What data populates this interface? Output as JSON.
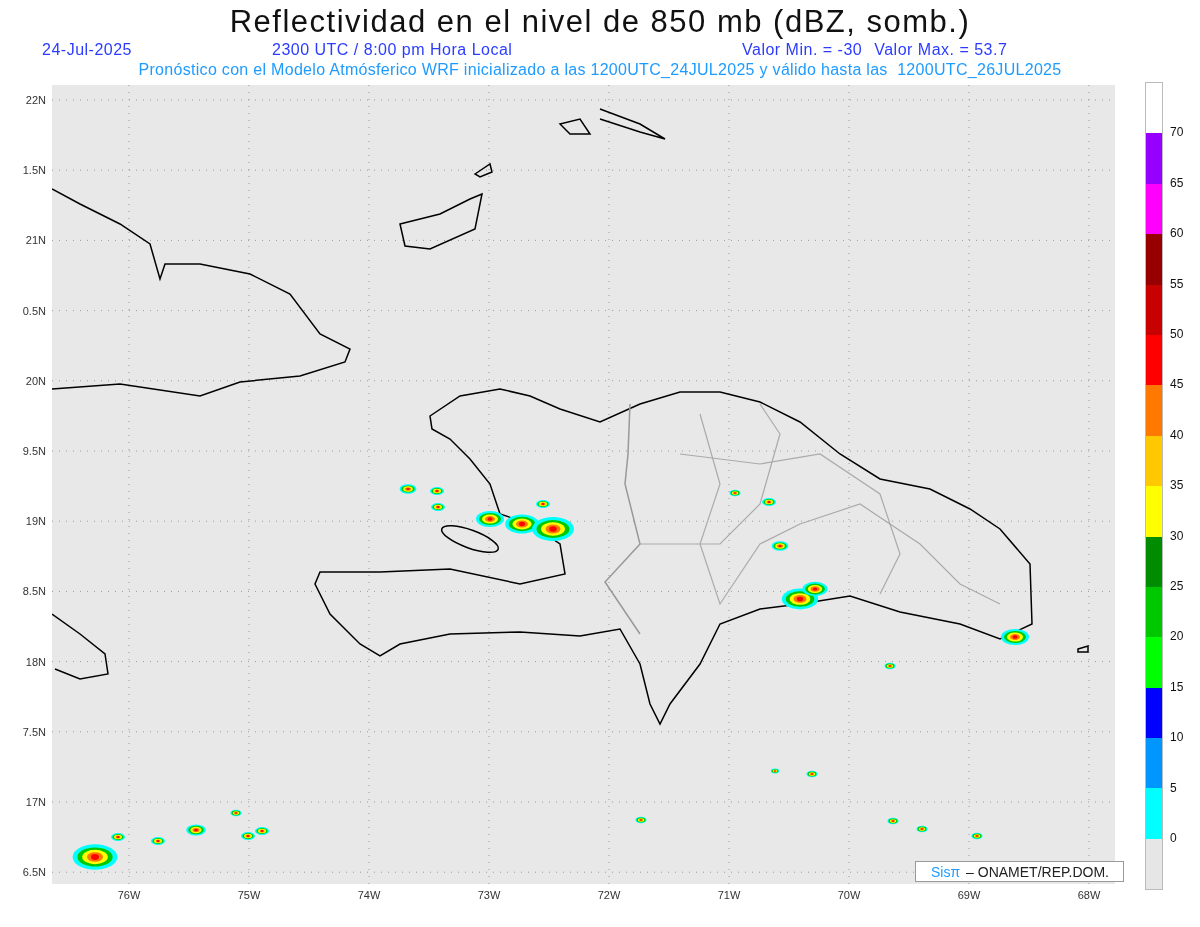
{
  "title": "Reflectividad en el nivel de 850 mb (dBZ, somb.)",
  "info": {
    "date": "24-Jul-2025",
    "time": "2300 UTC / 8:00 pm Hora Local",
    "min": "Valor Min. = -30",
    "max": "Valor Max. = 53.7"
  },
  "subtitle": "Pronóstico con el Modelo Atmósferico WRF inicializado a las 1200UTC_24JUL2025 y válido hasta las  1200UTC_26JUL2025",
  "y_labels": [
    "22N",
    "1.5N",
    "21N",
    "0.5N",
    "20N",
    "9.5N",
    "19N",
    "8.5N",
    "18N",
    "7.5N",
    "17N",
    "6.5N"
  ],
  "x_labels": [
    "76W",
    "75W",
    "74W",
    "73W",
    "72W",
    "71W",
    "70W",
    "69W",
    "68W"
  ],
  "colorbar": {
    "top_label": "70",
    "bins": [
      {
        "color": "#9600ff",
        "label": "65"
      },
      {
        "color": "#ff00ff",
        "label": "60"
      },
      {
        "color": "#960000",
        "label": "55"
      },
      {
        "color": "#c80000",
        "label": "50"
      },
      {
        "color": "#ff0000",
        "label": "45"
      },
      {
        "color": "#ff7800",
        "label": "40"
      },
      {
        "color": "#ffc800",
        "label": "35"
      },
      {
        "color": "#ffff00",
        "label": "30"
      },
      {
        "color": "#008c00",
        "label": "25"
      },
      {
        "color": "#00c800",
        "label": "20"
      },
      {
        "color": "#00ff00",
        "label": "15"
      },
      {
        "color": "#0000ff",
        "label": "10"
      },
      {
        "color": "#0096ff",
        "label": "5"
      },
      {
        "color": "#00ffff",
        "label": "0"
      },
      {
        "color": "#e6e6e6"
      }
    ]
  },
  "credit": {
    "brand": "Sisπ",
    "text": "– ONAMET/REP.DOM."
  }
}
